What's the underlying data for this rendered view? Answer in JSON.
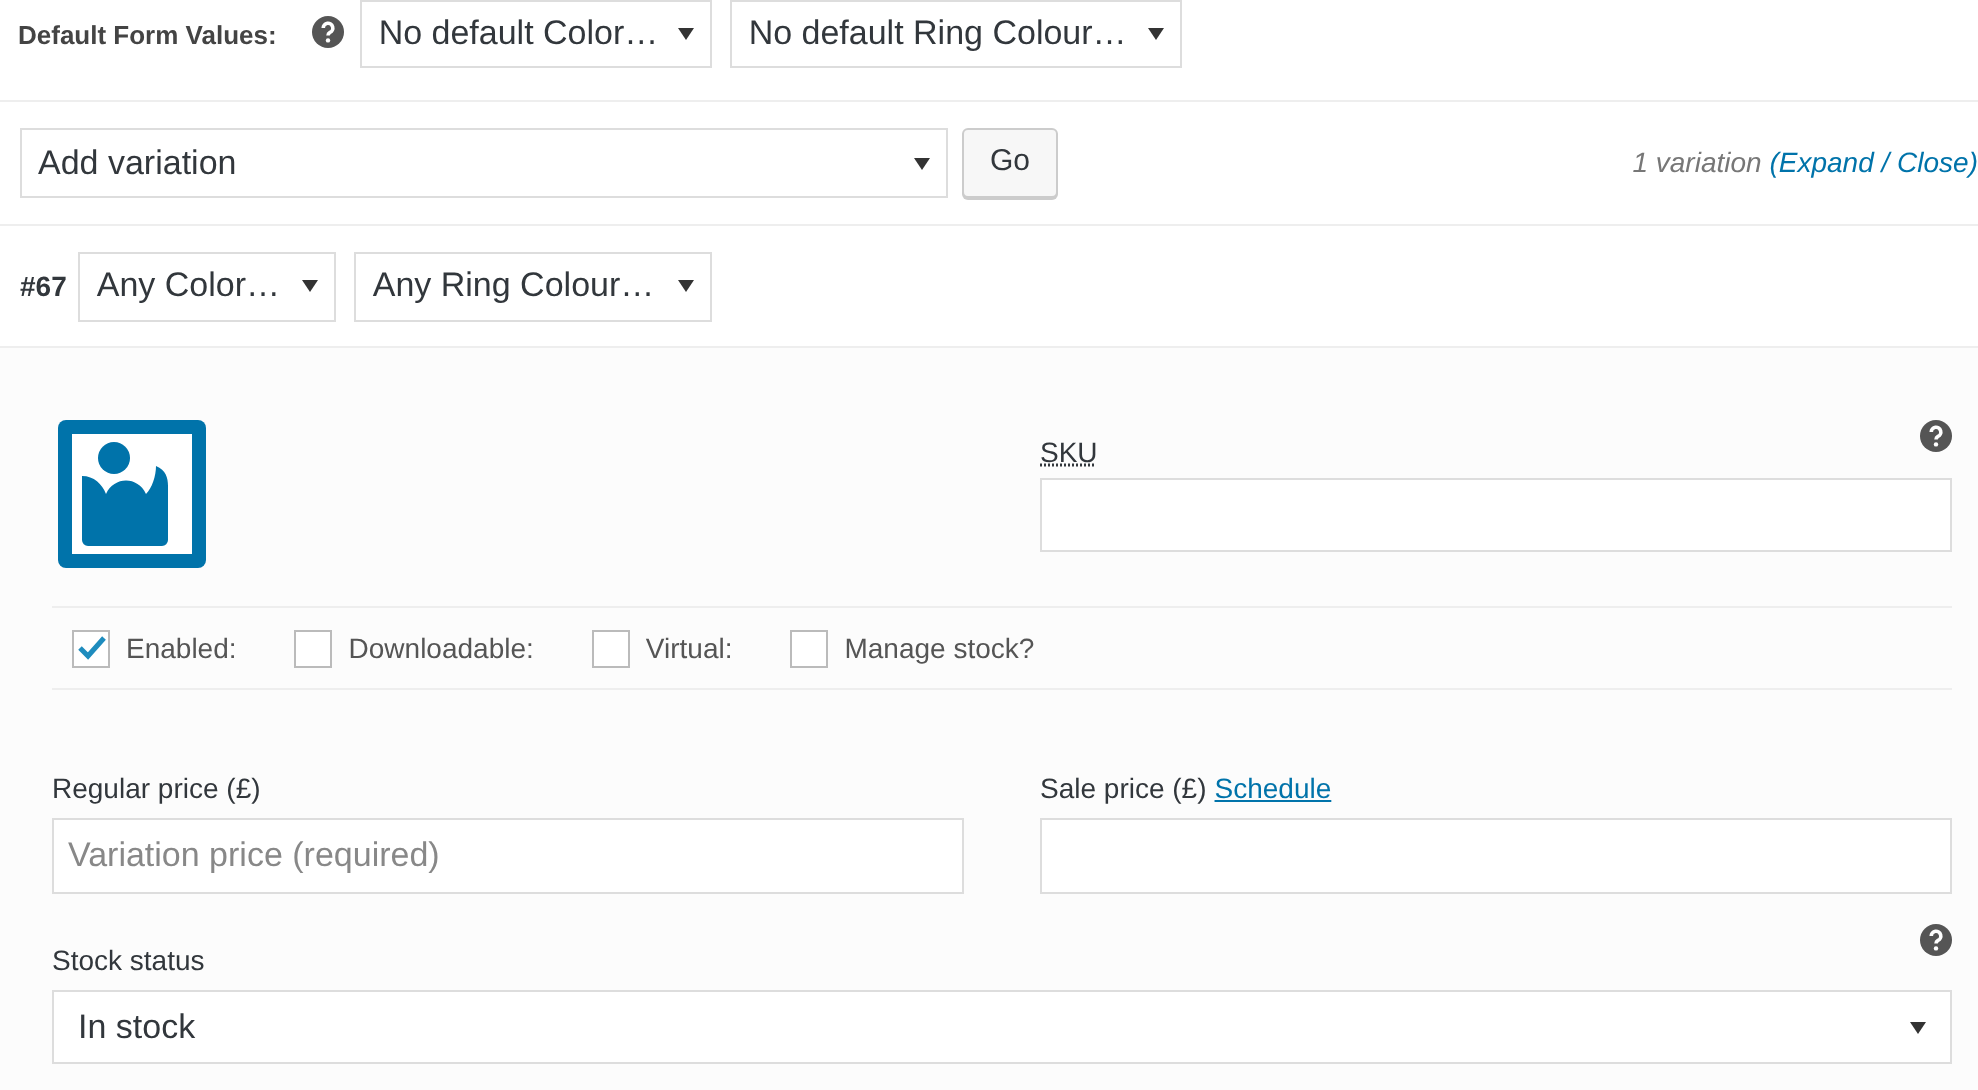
{
  "defaults": {
    "label": "Default Form Values:",
    "selects": [
      "No default Color…",
      "No default Ring Colour…"
    ]
  },
  "add_bar": {
    "select": "Add variation",
    "button": "Go",
    "count": "1 variation",
    "open_paren": "(",
    "expand": "Expand",
    "separator": "/",
    "close": "Close)"
  },
  "variation": {
    "number": "#67",
    "selects": [
      "Any Color…",
      "Any Ring Colour…"
    ],
    "sku": {
      "label": "SKU"
    },
    "options": [
      {
        "label": "Enabled:",
        "checked": true
      },
      {
        "label": "Downloadable:",
        "checked": false
      },
      {
        "label": "Virtual:",
        "checked": false
      },
      {
        "label": "Manage stock?",
        "checked": false
      }
    ],
    "regular_price": {
      "label": "Regular price (£)",
      "placeholder": "Variation price (required)"
    },
    "sale_price": {
      "label": "Sale price (£)",
      "link": "Schedule"
    },
    "stock_status": {
      "label": "Stock status",
      "value": "In stock"
    }
  }
}
